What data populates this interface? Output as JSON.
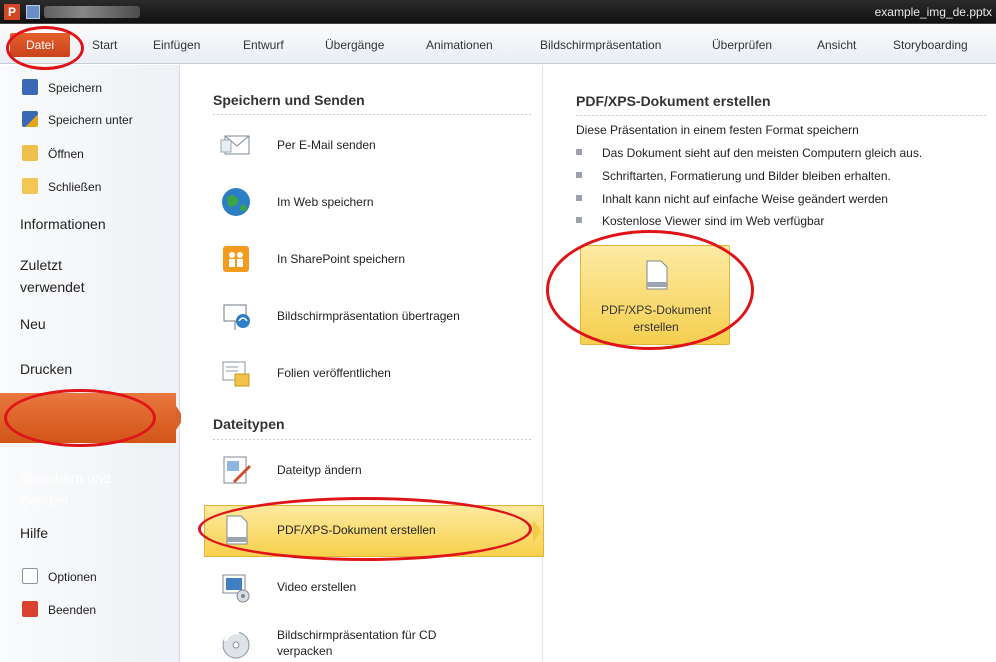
{
  "window": {
    "title": "example_img_de.pptx"
  },
  "ribbon": {
    "file_tab": "Datei",
    "tabs": [
      "Start",
      "Einfügen",
      "Entwurf",
      "Übergänge",
      "Animationen",
      "Bildschirmpräsentation",
      "Überprüfen",
      "Ansicht",
      "Storyboarding"
    ]
  },
  "nav": {
    "save": "Speichern",
    "save_as": "Speichern unter",
    "open": "Öffnen",
    "close": "Schließen",
    "info": "Informationen",
    "recent_line1": "Zuletzt",
    "recent_line2": "verwendet",
    "new": "Neu",
    "print": "Drucken",
    "share_line1": "Speichern und",
    "share_line2": "Senden",
    "help": "Hilfe",
    "options": "Optionen",
    "exit": "Beenden"
  },
  "middle": {
    "section1_title": "Speichern und Senden",
    "section2_title": "Dateitypen",
    "options": [
      {
        "label": "Per E-Mail senden",
        "icon": "email-icon"
      },
      {
        "label": "Im Web speichern",
        "icon": "globe-icon"
      },
      {
        "label": "In SharePoint speichern",
        "icon": "sharepoint-icon"
      },
      {
        "label": "Bildschirmpräsentation übertragen",
        "icon": "broadcast-icon"
      },
      {
        "label": "Folien veröffentlichen",
        "icon": "publish-slides-icon"
      },
      {
        "label": "Dateityp ändern",
        "icon": "change-filetype-icon"
      },
      {
        "label": "PDF/XPS-Dokument erstellen",
        "icon": "pdf-document-icon"
      },
      {
        "label": "Video erstellen",
        "icon": "video-icon"
      },
      {
        "label_line1": "Bildschirmpräsentation für CD",
        "label_line2": "verpacken",
        "icon": "cd-icon"
      }
    ]
  },
  "right": {
    "title": "PDF/XPS-Dokument erstellen",
    "description": "Diese Präsentation in einem festen Format speichern",
    "bullets": [
      "Das Dokument sieht auf den meisten Computern gleich aus.",
      "Schriftarten, Formatierung und Bilder bleiben erhalten.",
      "Inhalt kann nicht auf einfache Weise geändert werden",
      "Kostenlose Viewer sind im Web verfügbar"
    ],
    "button_line1": "PDF/XPS-Dokument",
    "button_line2": "erstellen"
  },
  "colors": {
    "accent": "#d9602a",
    "highlight": "#f8d04c",
    "annotation": "#e01418"
  }
}
